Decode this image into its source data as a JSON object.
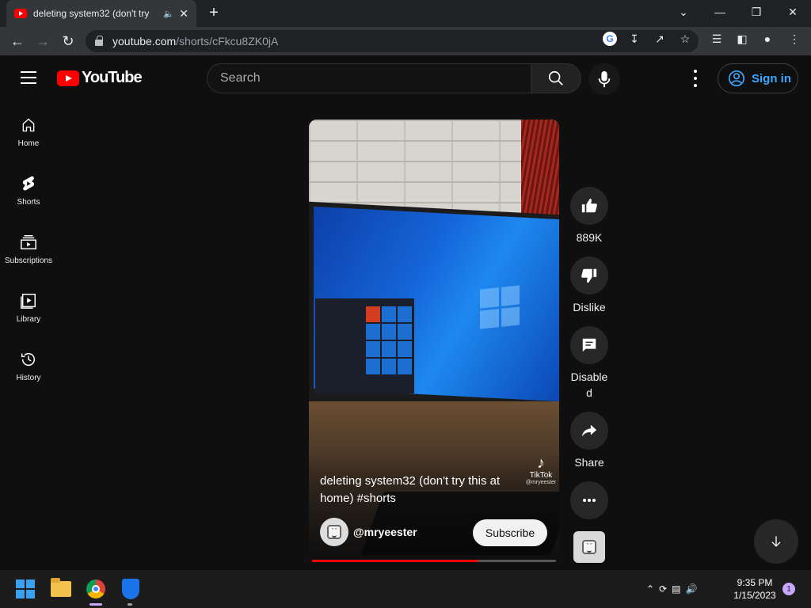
{
  "browser": {
    "tab_title": "deleting system32 (don't try",
    "url_host": "youtube.com",
    "url_path": "/shorts/cFkcu8ZK0jA"
  },
  "youtube": {
    "logo_text": "YouTube",
    "search_placeholder": "Search",
    "sign_in_label": "Sign in"
  },
  "sidebar": {
    "items": [
      {
        "label": "Home",
        "icon": "home-icon"
      },
      {
        "label": "Shorts",
        "icon": "shorts-icon"
      },
      {
        "label": "Subscriptions",
        "icon": "subscriptions-icon"
      },
      {
        "label": "Library",
        "icon": "library-icon"
      },
      {
        "label": "History",
        "icon": "history-icon"
      }
    ]
  },
  "short": {
    "title": "deleting system32 (don't try this at home) #shorts",
    "channel": "@mryeester",
    "subscribe_label": "Subscribe",
    "watermark_brand": "TikTok",
    "watermark_handle": "@mryeester",
    "progress": 0.68
  },
  "actions": {
    "like_count": "889K",
    "dislike_label": "Dislike",
    "comments_label": "Disabled",
    "share_label": "Share"
  },
  "taskbar": {
    "time": "9:35 PM",
    "date": "1/15/2023",
    "notification_count": "1"
  },
  "colors": {
    "youtube_red": "#ff0000",
    "link_blue": "#3ea6ff",
    "background": "#0f0f0f"
  }
}
